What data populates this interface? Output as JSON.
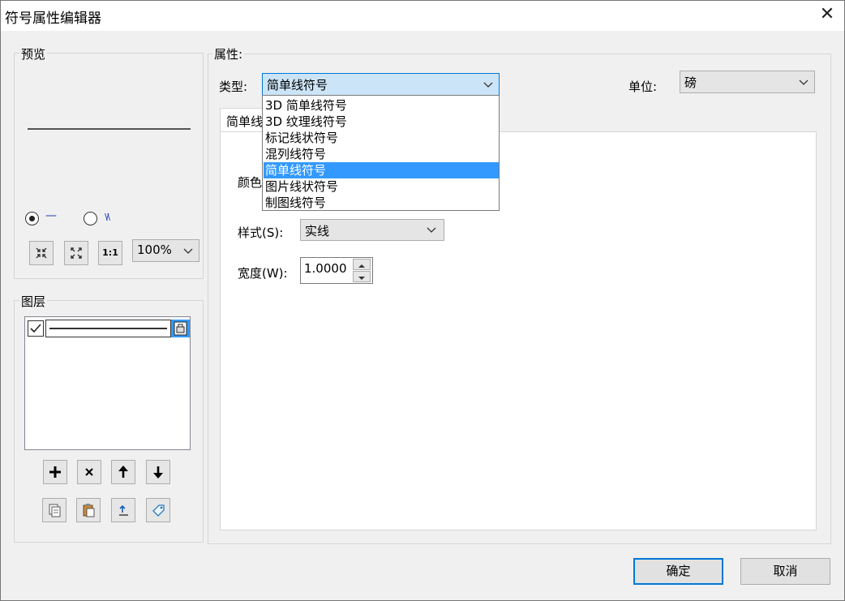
{
  "window": {
    "title": "符号属性编辑器",
    "close_glyph": "✕"
  },
  "preview": {
    "group_label": "预览",
    "radio_line": {
      "selected": true,
      "glyph": "—"
    },
    "radio_wave": {
      "selected": false,
      "glyph": "\\/\\"
    },
    "zoom": {
      "value": "100%"
    },
    "buttons": [
      "zoom-in-icon",
      "zoom-fit-icon",
      "actual-size-icon"
    ],
    "actual_size_label": "1:1"
  },
  "layers": {
    "group_label": "图层",
    "items": [
      {
        "checked": true
      }
    ],
    "tool_buttons": [
      "add-icon",
      "remove-icon",
      "move-up-icon",
      "move-down-icon"
    ],
    "action_buttons": [
      "copy-icon",
      "paste-icon",
      "reset-icon",
      "tag-icon"
    ]
  },
  "properties": {
    "group_label": "属性:",
    "type_label": "类型:",
    "type_value": "简单线符号",
    "unit_label": "单位:",
    "unit_value": "磅",
    "tab_label": "简单线",
    "color_label": "颜色",
    "style_label": "样式(S):",
    "style_value": "实线",
    "width_label": "宽度(W):",
    "width_value": "1.0000"
  },
  "type_dropdown": {
    "options": [
      "3D 简单线符号",
      "3D 纹理线符号",
      "标记线状符号",
      "混列线符号",
      "简单线符号",
      "图片线状符号",
      "制图线符号"
    ],
    "selected_index": 4
  },
  "footer": {
    "ok_label": "确定",
    "cancel_label": "取消"
  },
  "colors": {
    "accent": "#0078d7",
    "selection": "#3399ff",
    "combo_focus": "#cce4f7"
  }
}
